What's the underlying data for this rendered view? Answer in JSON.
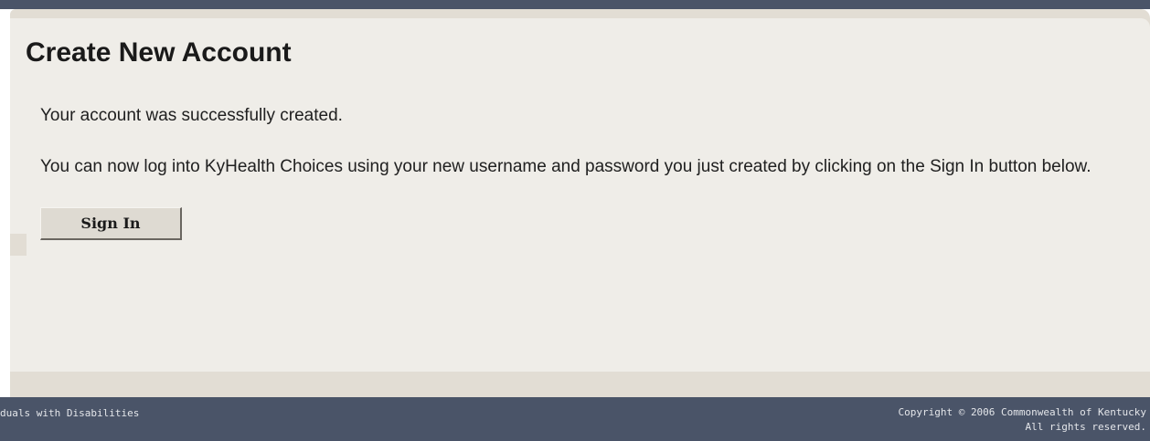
{
  "page": {
    "title": "Create New Account",
    "success_message": "Your account was successfully created.",
    "instruction_message": "You can now log into KyHealth Choices using your new username and password you just created by clicking on the Sign In button below."
  },
  "actions": {
    "sign_in_label": "Sign In"
  },
  "footer": {
    "left_text": "duals with Disabilities",
    "copyright_line1": "Copyright © 2006 Commonwealth of Kentucky",
    "copyright_line2": "All rights reserved."
  }
}
